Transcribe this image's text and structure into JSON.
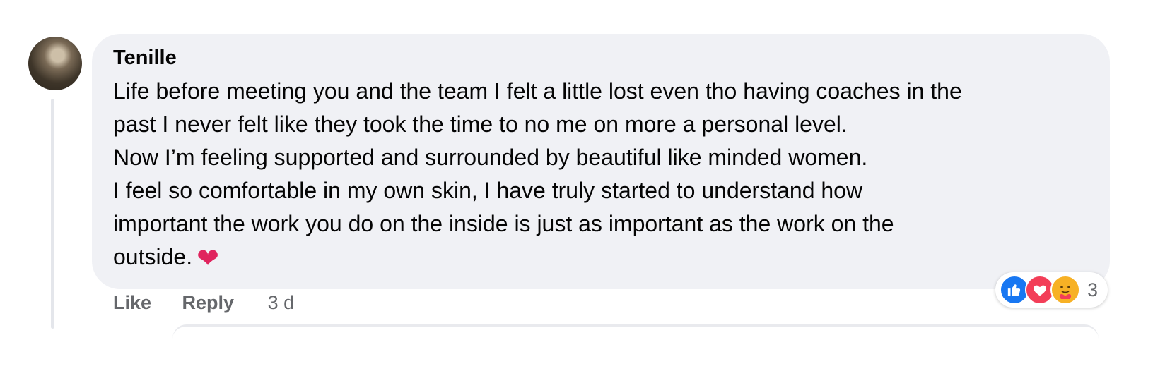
{
  "comment": {
    "author": "Tenille",
    "lines": [
      "Life before meeting you and the team I felt a little lost even tho having coaches in the",
      "past I never felt like they took the time to no me on more a personal level.",
      "Now I’m feeling supported and surrounded by beautiful like minded women.",
      "I feel so comfortable in my own skin, I have truly started to understand how",
      "important the work you do on the inside is just as important as the work on the",
      "outside."
    ],
    "emoji": "❤"
  },
  "actions": {
    "like_label": "Like",
    "reply_label": "Reply",
    "timestamp": "3 d"
  },
  "reactions": {
    "icons": [
      "like-icon",
      "love-icon",
      "care-icon"
    ],
    "count": "3"
  },
  "colors": {
    "bubble": "#f0f1f5",
    "like": "#1877f2",
    "love": "#f33e58",
    "care": "#f7b125",
    "secondary_text": "#65676b"
  }
}
